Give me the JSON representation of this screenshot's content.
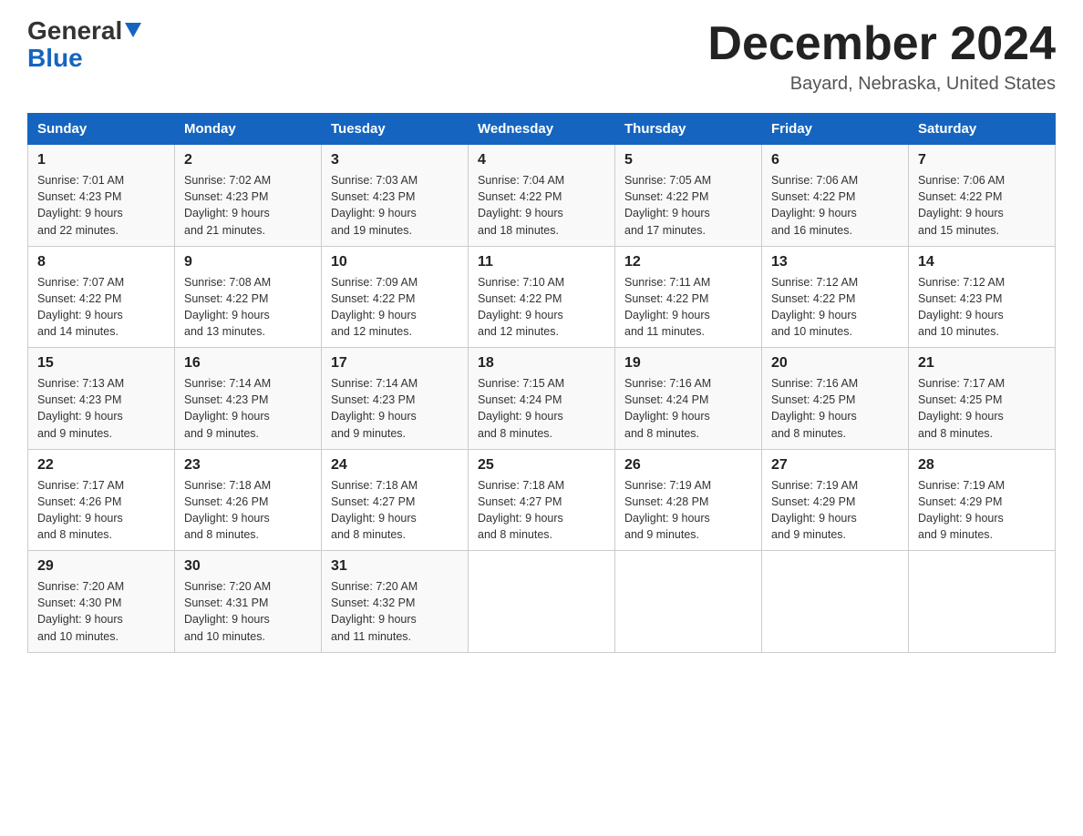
{
  "header": {
    "logo_general": "General",
    "logo_blue": "Blue",
    "title": "December 2024",
    "subtitle": "Bayard, Nebraska, United States"
  },
  "days_of_week": [
    "Sunday",
    "Monday",
    "Tuesday",
    "Wednesday",
    "Thursday",
    "Friday",
    "Saturday"
  ],
  "weeks": [
    [
      {
        "date": "1",
        "sunrise": "7:01 AM",
        "sunset": "4:23 PM",
        "daylight": "9 hours and 22 minutes."
      },
      {
        "date": "2",
        "sunrise": "7:02 AM",
        "sunset": "4:23 PM",
        "daylight": "9 hours and 21 minutes."
      },
      {
        "date": "3",
        "sunrise": "7:03 AM",
        "sunset": "4:23 PM",
        "daylight": "9 hours and 19 minutes."
      },
      {
        "date": "4",
        "sunrise": "7:04 AM",
        "sunset": "4:22 PM",
        "daylight": "9 hours and 18 minutes."
      },
      {
        "date": "5",
        "sunrise": "7:05 AM",
        "sunset": "4:22 PM",
        "daylight": "9 hours and 17 minutes."
      },
      {
        "date": "6",
        "sunrise": "7:06 AM",
        "sunset": "4:22 PM",
        "daylight": "9 hours and 16 minutes."
      },
      {
        "date": "7",
        "sunrise": "7:06 AM",
        "sunset": "4:22 PM",
        "daylight": "9 hours and 15 minutes."
      }
    ],
    [
      {
        "date": "8",
        "sunrise": "7:07 AM",
        "sunset": "4:22 PM",
        "daylight": "9 hours and 14 minutes."
      },
      {
        "date": "9",
        "sunrise": "7:08 AM",
        "sunset": "4:22 PM",
        "daylight": "9 hours and 13 minutes."
      },
      {
        "date": "10",
        "sunrise": "7:09 AM",
        "sunset": "4:22 PM",
        "daylight": "9 hours and 12 minutes."
      },
      {
        "date": "11",
        "sunrise": "7:10 AM",
        "sunset": "4:22 PM",
        "daylight": "9 hours and 12 minutes."
      },
      {
        "date": "12",
        "sunrise": "7:11 AM",
        "sunset": "4:22 PM",
        "daylight": "9 hours and 11 minutes."
      },
      {
        "date": "13",
        "sunrise": "7:12 AM",
        "sunset": "4:22 PM",
        "daylight": "9 hours and 10 minutes."
      },
      {
        "date": "14",
        "sunrise": "7:12 AM",
        "sunset": "4:23 PM",
        "daylight": "9 hours and 10 minutes."
      }
    ],
    [
      {
        "date": "15",
        "sunrise": "7:13 AM",
        "sunset": "4:23 PM",
        "daylight": "9 hours and 9 minutes."
      },
      {
        "date": "16",
        "sunrise": "7:14 AM",
        "sunset": "4:23 PM",
        "daylight": "9 hours and 9 minutes."
      },
      {
        "date": "17",
        "sunrise": "7:14 AM",
        "sunset": "4:23 PM",
        "daylight": "9 hours and 9 minutes."
      },
      {
        "date": "18",
        "sunrise": "7:15 AM",
        "sunset": "4:24 PM",
        "daylight": "9 hours and 8 minutes."
      },
      {
        "date": "19",
        "sunrise": "7:16 AM",
        "sunset": "4:24 PM",
        "daylight": "9 hours and 8 minutes."
      },
      {
        "date": "20",
        "sunrise": "7:16 AM",
        "sunset": "4:25 PM",
        "daylight": "9 hours and 8 minutes."
      },
      {
        "date": "21",
        "sunrise": "7:17 AM",
        "sunset": "4:25 PM",
        "daylight": "9 hours and 8 minutes."
      }
    ],
    [
      {
        "date": "22",
        "sunrise": "7:17 AM",
        "sunset": "4:26 PM",
        "daylight": "9 hours and 8 minutes."
      },
      {
        "date": "23",
        "sunrise": "7:18 AM",
        "sunset": "4:26 PM",
        "daylight": "9 hours and 8 minutes."
      },
      {
        "date": "24",
        "sunrise": "7:18 AM",
        "sunset": "4:27 PM",
        "daylight": "9 hours and 8 minutes."
      },
      {
        "date": "25",
        "sunrise": "7:18 AM",
        "sunset": "4:27 PM",
        "daylight": "9 hours and 8 minutes."
      },
      {
        "date": "26",
        "sunrise": "7:19 AM",
        "sunset": "4:28 PM",
        "daylight": "9 hours and 9 minutes."
      },
      {
        "date": "27",
        "sunrise": "7:19 AM",
        "sunset": "4:29 PM",
        "daylight": "9 hours and 9 minutes."
      },
      {
        "date": "28",
        "sunrise": "7:19 AM",
        "sunset": "4:29 PM",
        "daylight": "9 hours and 9 minutes."
      }
    ],
    [
      {
        "date": "29",
        "sunrise": "7:20 AM",
        "sunset": "4:30 PM",
        "daylight": "9 hours and 10 minutes."
      },
      {
        "date": "30",
        "sunrise": "7:20 AM",
        "sunset": "4:31 PM",
        "daylight": "9 hours and 10 minutes."
      },
      {
        "date": "31",
        "sunrise": "7:20 AM",
        "sunset": "4:32 PM",
        "daylight": "9 hours and 11 minutes."
      },
      null,
      null,
      null,
      null
    ]
  ],
  "labels": {
    "sunrise": "Sunrise:",
    "sunset": "Sunset:",
    "daylight": "Daylight:"
  }
}
